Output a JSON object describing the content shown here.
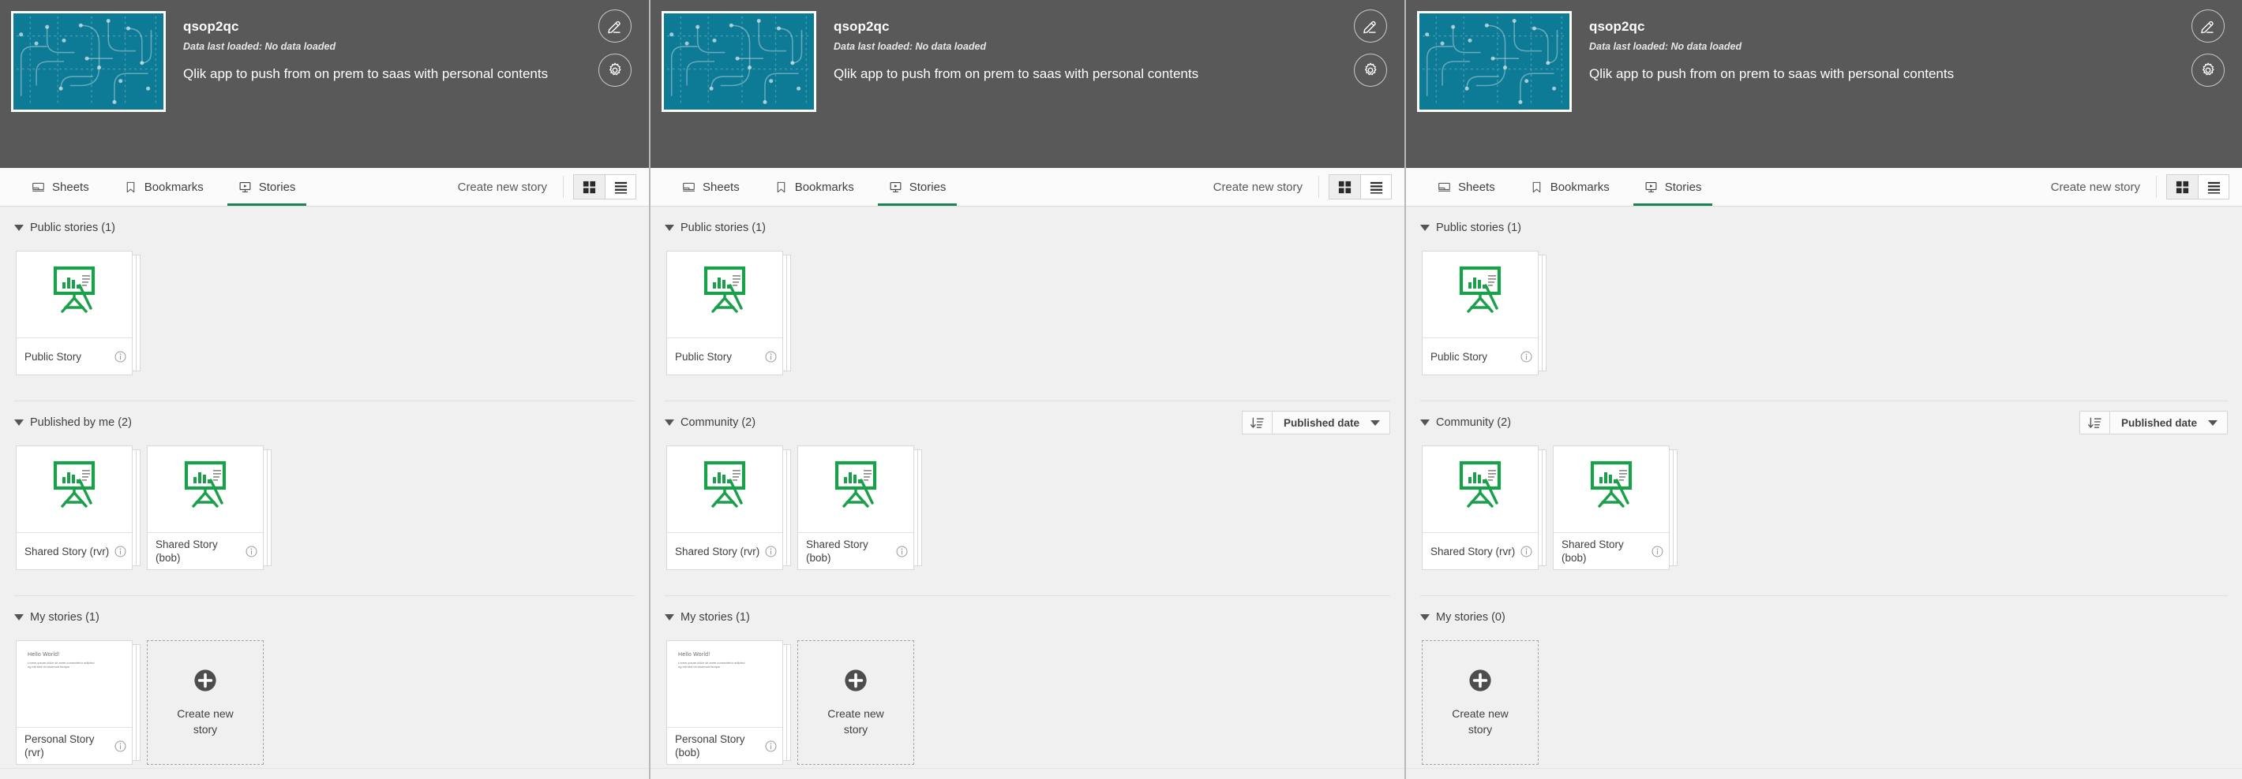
{
  "colors": {
    "accent_green": "#1a8553",
    "header_bg": "#595959",
    "app_thumb_bg": "#0d7a96",
    "body_bg": "#f0f0f0"
  },
  "app": {
    "title": "qsop2qc",
    "data_loaded": "Data last loaded: No data loaded",
    "description": "Qlik app to push from on prem to saas with personal contents",
    "thumbnail_icon": "app-circuit-thumbnail",
    "actions": [
      {
        "name": "edit-app-button",
        "icon": "pencil-icon"
      },
      {
        "name": "app-settings-button",
        "icon": "gear-icon"
      }
    ]
  },
  "toolbar": {
    "tabs": [
      {
        "label": "Sheets",
        "icon": "sheet-icon",
        "active": false
      },
      {
        "label": "Bookmarks",
        "icon": "bookmark-icon",
        "active": false
      },
      {
        "label": "Stories",
        "icon": "story-icon",
        "active": true
      }
    ],
    "create_label": "Create new story",
    "view_grid_icon": "grid-view-icon",
    "view_list_icon": "list-view-icon",
    "view_active": "grid"
  },
  "sort": {
    "order_icon": "sort-descending-icon",
    "value": "Published date",
    "caret_icon": "chevron-down-icon"
  },
  "icons": {
    "story": "easel-chart-icon",
    "info": "info-circle-icon",
    "plus": "plus-circle-icon",
    "caret": "caret-down-icon"
  },
  "create_tile_label": "Create new story",
  "thumb_text": {
    "line1": "Hello World!",
    "line2": "Lorem ipsum dolor sit amet consectetur adipiscing elit sed do eiusmod tempor"
  },
  "panels": [
    {
      "id": "panel-left",
      "sections": [
        {
          "title": "Public stories (1)",
          "has_sort": false,
          "cards": [
            {
              "name": "Public Story",
              "thumb": "story",
              "stacked": true
            }
          ],
          "show_create": false
        },
        {
          "title": "Published by me (2)",
          "has_sort": false,
          "cards": [
            {
              "name": "Shared Story (rvr)",
              "thumb": "story",
              "stacked": true
            },
            {
              "name": "Shared Story (bob)",
              "thumb": "story",
              "stacked": true
            }
          ],
          "show_create": false
        },
        {
          "title": "My stories (1)",
          "has_sort": false,
          "cards": [
            {
              "name": "Personal Story (rvr)",
              "thumb": "text",
              "stacked": true
            }
          ],
          "show_create": true
        }
      ]
    },
    {
      "id": "panel-middle",
      "sections": [
        {
          "title": "Public stories (1)",
          "has_sort": false,
          "cards": [
            {
              "name": "Public Story",
              "thumb": "story",
              "stacked": true
            }
          ],
          "show_create": false
        },
        {
          "title": "Community (2)",
          "has_sort": true,
          "cards": [
            {
              "name": "Shared Story (rvr)",
              "thumb": "story",
              "stacked": true
            },
            {
              "name": "Shared Story (bob)",
              "thumb": "story",
              "stacked": true
            }
          ],
          "show_create": false
        },
        {
          "title": "My stories (1)",
          "has_sort": false,
          "cards": [
            {
              "name": "Personal Story (bob)",
              "thumb": "text",
              "stacked": true
            }
          ],
          "show_create": true
        }
      ]
    },
    {
      "id": "panel-right",
      "sections": [
        {
          "title": "Public stories (1)",
          "has_sort": false,
          "cards": [
            {
              "name": "Public Story",
              "thumb": "story",
              "stacked": true
            }
          ],
          "show_create": false
        },
        {
          "title": "Community (2)",
          "has_sort": true,
          "cards": [
            {
              "name": "Shared Story (rvr)",
              "thumb": "story",
              "stacked": true
            },
            {
              "name": "Shared Story (bob)",
              "thumb": "story",
              "stacked": true
            }
          ],
          "show_create": false
        },
        {
          "title": "My stories (0)",
          "has_sort": false,
          "cards": [],
          "show_create": true
        }
      ]
    }
  ]
}
